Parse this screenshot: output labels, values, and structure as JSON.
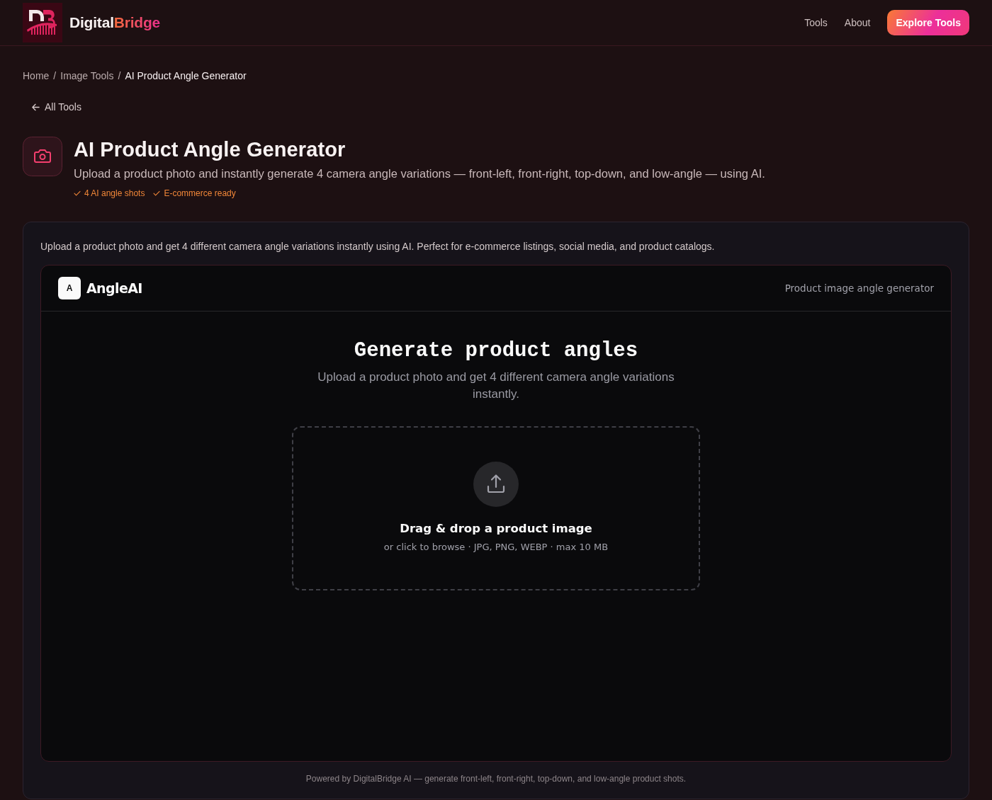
{
  "header": {
    "brand": {
      "part_1": "Digital",
      "part_2": "Bridge"
    },
    "nav": [
      {
        "label": "Tools"
      },
      {
        "label": "About"
      }
    ],
    "cta": "Explore Tools"
  },
  "breadcrumb": {
    "separator": "/",
    "items": [
      {
        "label": "Home",
        "current": false
      },
      {
        "label": "Image Tools",
        "current": false
      },
      {
        "label": "AI Product Angle Generator",
        "current": true
      }
    ]
  },
  "back_link": {
    "label": "All Tools"
  },
  "tool": {
    "title": "AI Product Angle Generator",
    "description": "Upload a product photo and instantly generate 4 camera angle variations — front-left, front-right, top-down, and low-angle — using AI.",
    "features": [
      "4 AI angle shots",
      "E-commerce ready"
    ]
  },
  "panel": {
    "intro": "Upload a product photo and get 4 different camera angle variations instantly using AI. Perfect for e-commerce listings, social media, and product catalogs.",
    "app": {
      "logo_letter": "A",
      "name": "AngleAI",
      "tagline": "Product image angle generator",
      "heading": "Generate product angles",
      "subheading": "Upload a product photo and get 4 different camera angle variations instantly.",
      "dropzone": {
        "title": "Drag & drop a product image",
        "hint": "or click to browse · JPG, PNG, WEBP · max 10 MB"
      }
    },
    "footer": "Powered by DigitalBridge AI — generate front-left, front-right, top-down, and low-angle product shots."
  }
}
